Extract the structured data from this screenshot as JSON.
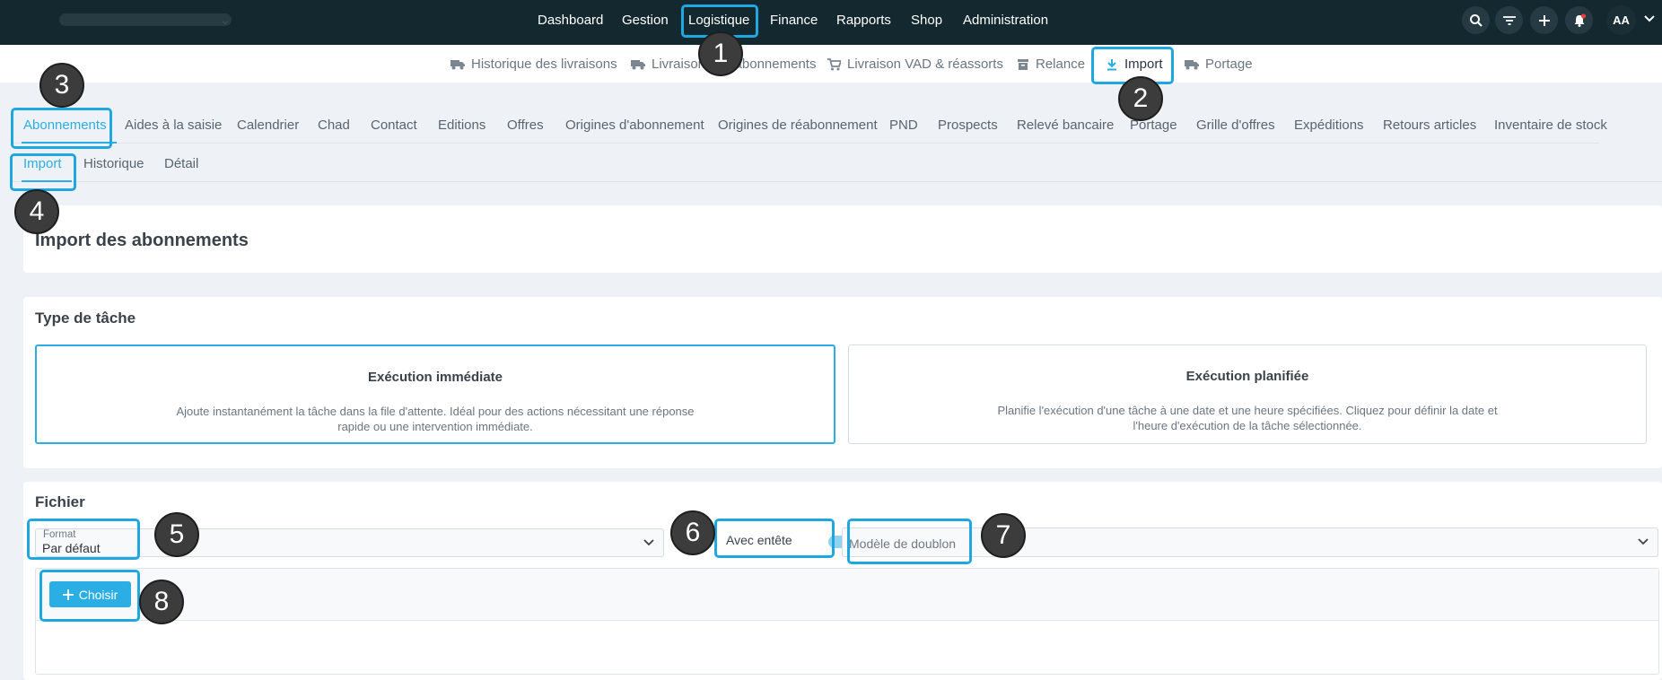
{
  "topnav": {
    "items": [
      "Dashboard",
      "Gestion",
      "Logistique",
      "Finance",
      "Rapports",
      "Shop",
      "Administration"
    ],
    "avatar": "AA"
  },
  "icons": {
    "search": "search-icon",
    "filter": "filter-icon",
    "add": "plus-icon",
    "notifications": "bell-icon",
    "user_menu": "chevron-down-icon"
  },
  "subnav": {
    "items": [
      {
        "label": "Historique des livraisons",
        "icon": "truck-icon"
      },
      {
        "label": "Livraison des abonnements",
        "icon": "truck-icon"
      },
      {
        "label": "Livraison VAD & réassorts",
        "icon": "cart-icon"
      },
      {
        "label": "Relance",
        "icon": "archive-icon"
      },
      {
        "label": "Import",
        "icon": "download-icon"
      },
      {
        "label": "Portage",
        "icon": "truck-icon"
      }
    ],
    "active": "Import"
  },
  "tabs_primary": {
    "items": [
      "Abonnements",
      "Aides à la saisie",
      "Calendrier",
      "Chad",
      "Contact",
      "Editions",
      "Offres",
      "Origines d'abonnement",
      "Origines de réabonnement",
      "PND",
      "Prospects",
      "Relevé bancaire",
      "Portage",
      "Grille d'offres",
      "Expéditions",
      "Retours articles",
      "Inventaire de stock"
    ],
    "active": "Abonnements"
  },
  "tabs_secondary": {
    "items": [
      "Import",
      "Historique",
      "Détail"
    ],
    "active": "Import"
  },
  "page_title": "Import des abonnements",
  "task_type": {
    "title": "Type de tâche",
    "options": [
      {
        "title": "Exécution immédiate",
        "desc": "Ajoute instantanément la tâche dans la file d'attente. Idéal pour des actions nécessitant une réponse rapide ou une intervention immédiate.",
        "selected": true
      },
      {
        "title": "Exécution planifiée",
        "desc": "Planifie l'exécution d'une tâche à une date et une heure spécifiées. Cliquez pour définir la date et l'heure d'exécution de la tâche sélectionnée.",
        "selected": false
      }
    ]
  },
  "file_section": {
    "title": "Fichier",
    "format_label": "Format",
    "format_value": "Par défaut",
    "header_toggle_label": "Avec entête",
    "header_toggle_on": true,
    "duplicate_placeholder": "Modèle de doublon",
    "choose_label": "Choisir"
  },
  "annotations": [
    "1",
    "2",
    "3",
    "4",
    "5",
    "6",
    "7",
    "8"
  ],
  "colors": {
    "topbar": "#14282f",
    "accent": "#2aaee4",
    "highlight": "#1fa7e2",
    "marker": "#3c3c3c",
    "background": "#eef2f6"
  }
}
